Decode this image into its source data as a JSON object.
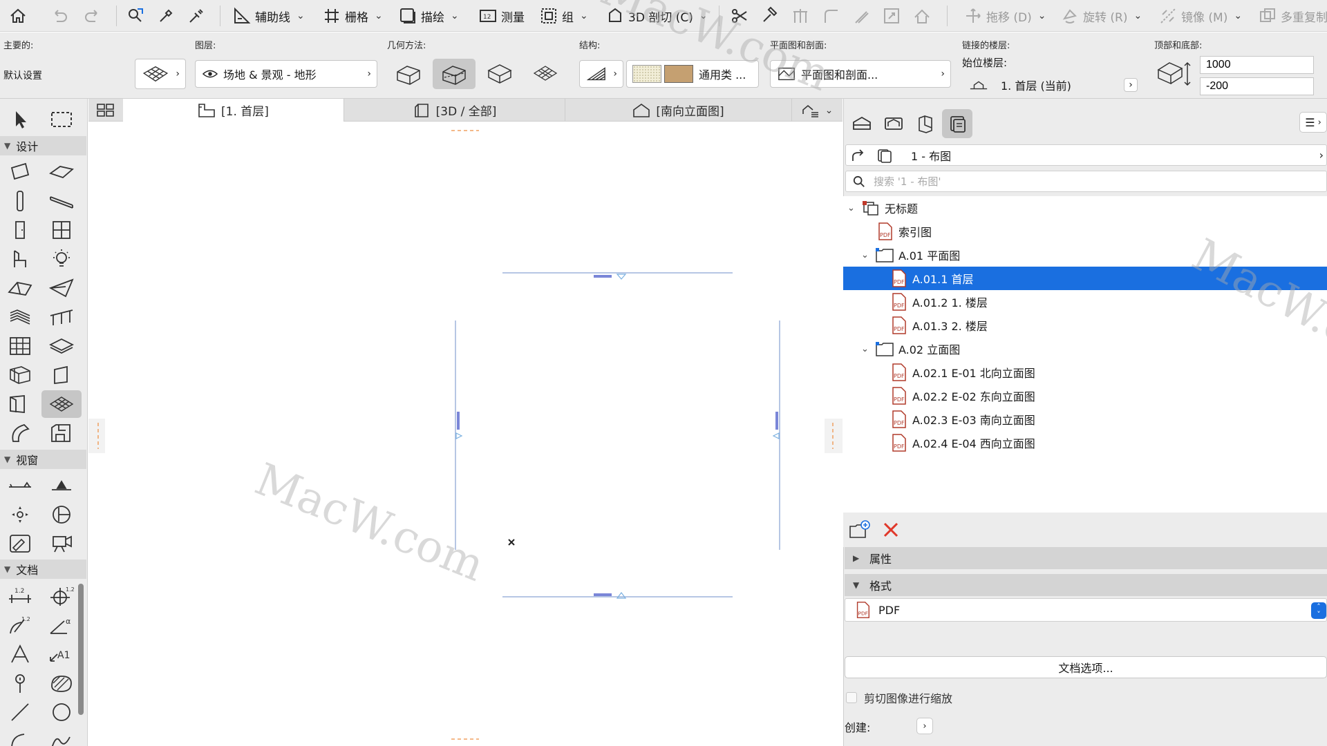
{
  "toolbar": {
    "guideline_label": "辅助线",
    "grid_label": "栅格",
    "trace_label": "描绘",
    "measure_label": "测量",
    "group_label": "组",
    "cutaway_label": "3D 剖切 (C)",
    "drag_label": "拖移 (D)",
    "rotate_label": "旋转 (R)",
    "mirror_label": "镜像 (M)",
    "multiply_label": "多重复制"
  },
  "infobox": {
    "main_caption": "主要的:",
    "default_settings": "默认设置",
    "layer_caption": "图层:",
    "layer_value": "场地 & 景观 - 地形",
    "geometry_caption": "几何方法:",
    "structure_caption": "结构:",
    "structure_value": "通用类 ...",
    "plan_section_caption": "平面图和剖面:",
    "plan_section_value": "平面图和剖面...",
    "linked_story_caption": "链接的楼层:",
    "home_story_label": "始位楼层:",
    "home_story_value": "1. 首层 (当前)",
    "top_bottom_caption": "顶部和底部:",
    "top_value": "1000",
    "bottom_value": "-200"
  },
  "toolbox": {
    "section_design": "设计",
    "section_viewpoint": "视窗",
    "section_document": "文档"
  },
  "tabs": [
    {
      "label": "[1. 首层]"
    },
    {
      "label": "[3D / 全部]"
    },
    {
      "label": "[南向立面图]"
    }
  ],
  "navigator": {
    "map_label": "1 - 布图",
    "search_placeholder": "搜索 '1 - 布图'",
    "tree": [
      {
        "label": "无标题"
      },
      {
        "label": "索引图"
      },
      {
        "label": "A.01 平面图"
      },
      {
        "label": "A.01.1 首层"
      },
      {
        "label": "A.01.2 1. 楼层"
      },
      {
        "label": "A.01.3 2. 楼层"
      },
      {
        "label": "A.02 立面图"
      },
      {
        "label": "A.02.1 E-01 北向立面图"
      },
      {
        "label": "A.02.2 E-02 东向立面图"
      },
      {
        "label": "A.02.3 E-03 南向立面图"
      },
      {
        "label": "A.02.4 E-04 西向立面图"
      }
    ],
    "properties_label": "属性",
    "format_label": "格式",
    "format_value": "PDF",
    "doc_options_label": "文档选项...",
    "scale_checkbox_label": "剪切图像进行缩放",
    "create_label": "创建:"
  },
  "icons": {
    "pdf_badge": "PDF"
  },
  "watermark": "MacW.com",
  "colors": {
    "selection": "#1a6fe0",
    "delete": "#e0382a",
    "marker": "#7a86d8",
    "guide": "#f0a060"
  }
}
